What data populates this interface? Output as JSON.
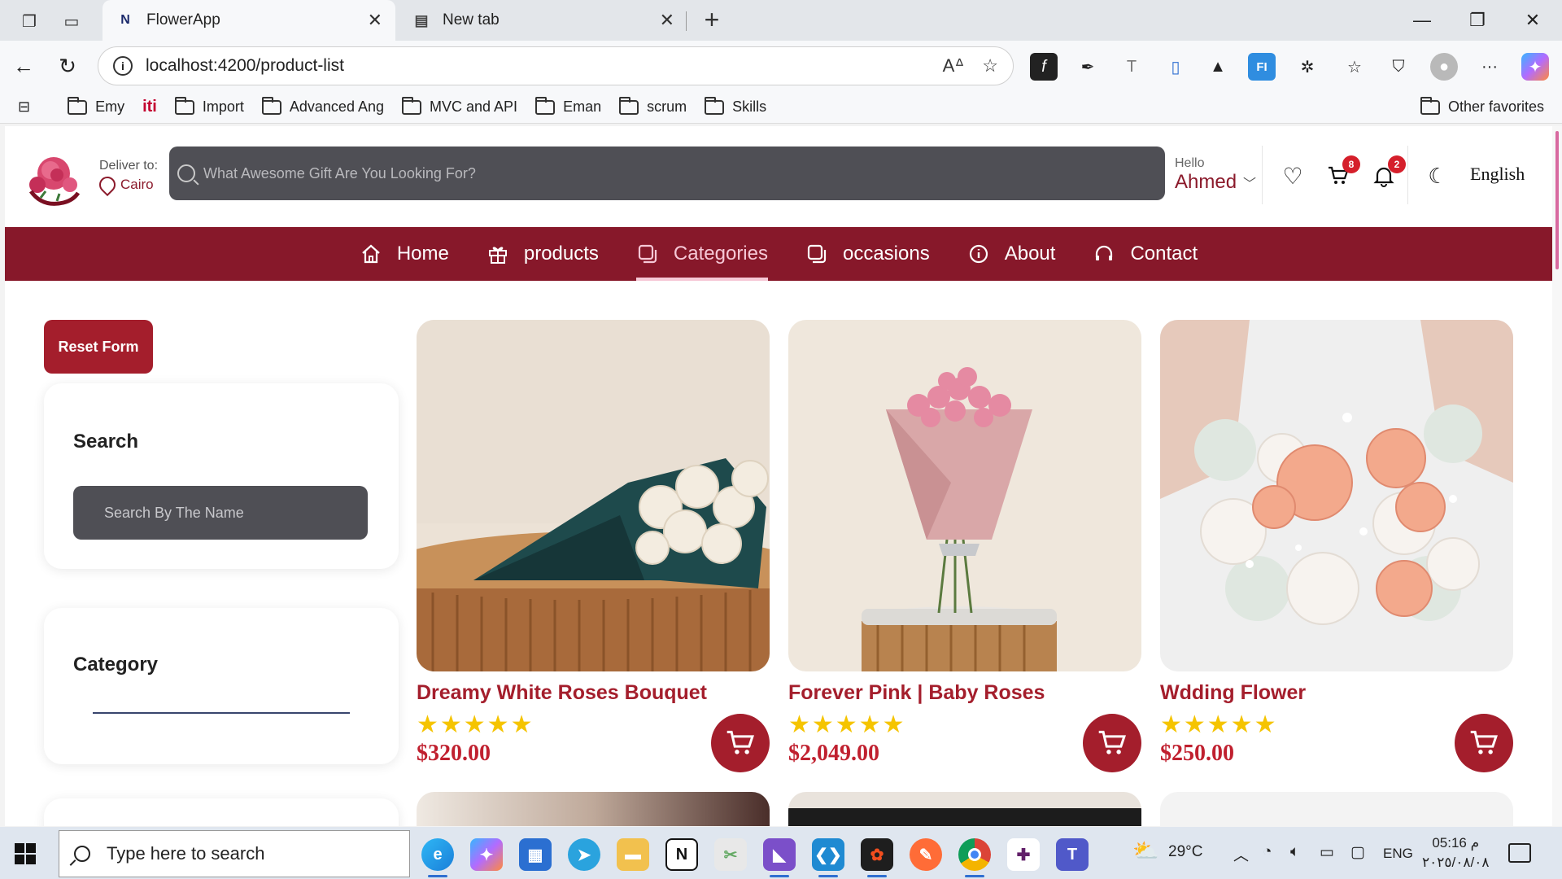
{
  "browser": {
    "tabs": [
      {
        "title": "FlowerApp",
        "favicon": "N"
      },
      {
        "title": "New tab"
      }
    ],
    "url": "localhost:4200/product-list",
    "read_aloud_icon": "A͖",
    "bookmarks": [
      "Emy",
      "Import",
      "Advanced Ang",
      "MVC and API",
      "Eman",
      "scrum",
      "Skills"
    ],
    "other_favorites": "Other favorites"
  },
  "header": {
    "deliver_label": "Deliver to:",
    "city": "Cairo",
    "search_placeholder": "What Awesome Gift Are You Looking For?",
    "hello_label": "Hello",
    "user_name": "Ahmed",
    "cart_count": "8",
    "notification_count": "2",
    "language": "English"
  },
  "nav": {
    "items": [
      {
        "label": "Home",
        "icon": "home-icon"
      },
      {
        "label": "products",
        "icon": "gift-icon"
      },
      {
        "label": "Categories",
        "icon": "categories-icon",
        "active": true
      },
      {
        "label": "occasions",
        "icon": "occasions-icon"
      },
      {
        "label": "About",
        "icon": "info-icon"
      },
      {
        "label": "Contact",
        "icon": "headset-icon"
      }
    ]
  },
  "sidebar": {
    "reset_label": "Reset Form",
    "search_title": "Search",
    "search_placeholder": "Search By The Name",
    "category_title": "Category"
  },
  "products": [
    {
      "name": "Dreamy White Roses Bouquet",
      "rating": 5,
      "stars": "★★★★★",
      "price": "$320.00"
    },
    {
      "name": "Forever Pink | Baby Roses",
      "rating": 5,
      "stars": "★★★★★",
      "price": "$2,049.00"
    },
    {
      "name": "Wdding Flower",
      "rating": 5,
      "stars": "★★★★★",
      "price": "$250.00"
    }
  ],
  "taskbar": {
    "search_placeholder": "Type here to search",
    "weather": "29°C",
    "language": "ENG",
    "time": "05:16 م",
    "date": "٢٠٢٥/٠٨/٠٨"
  },
  "colors": {
    "brand": "#87182a",
    "button": "#a41e2c",
    "price": "#c0202f",
    "star": "#f5c400",
    "search_bg": "#4f4f55"
  }
}
